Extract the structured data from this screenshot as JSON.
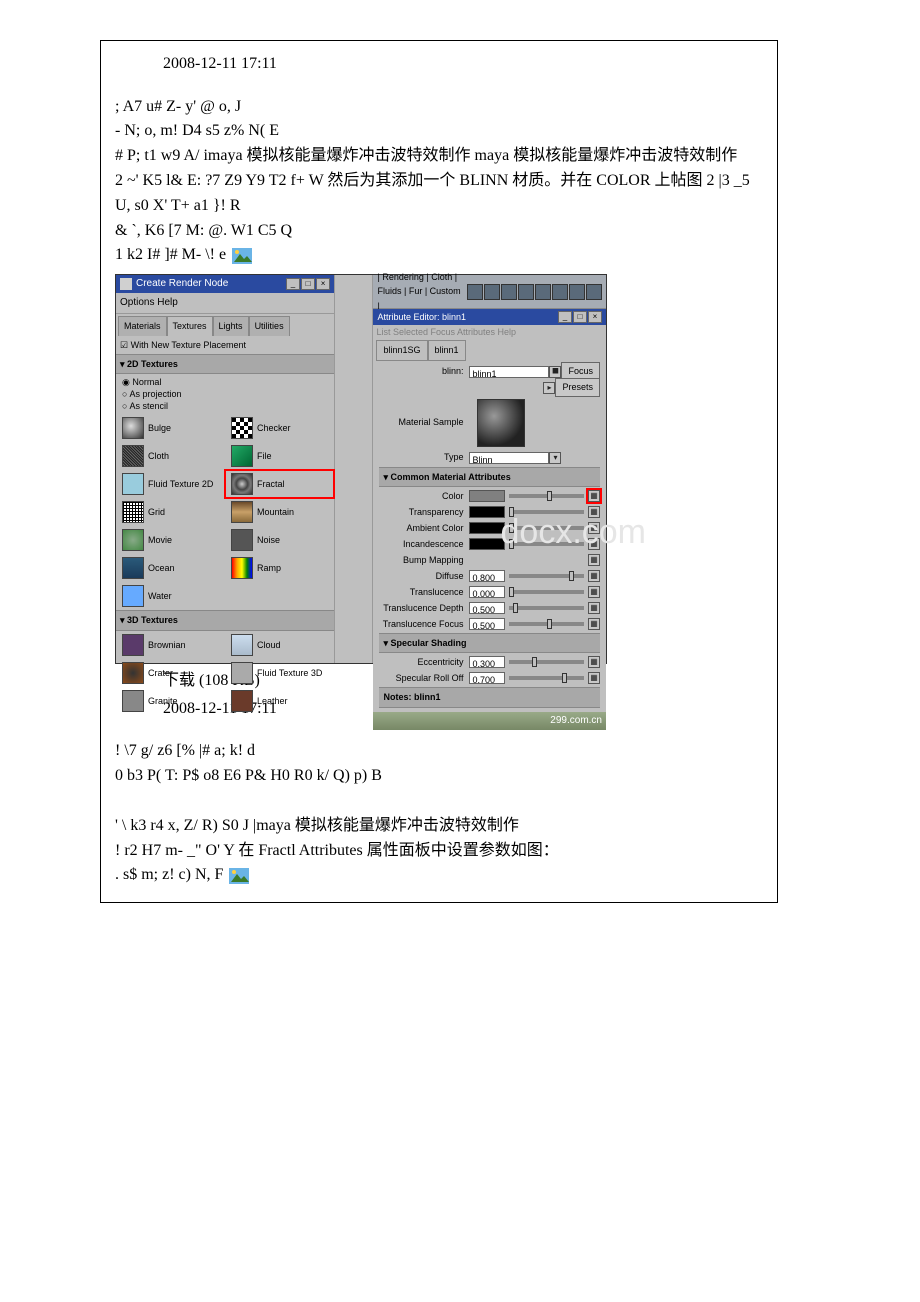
{
  "block1": {
    "timestamp": "2008-12-11 17:11",
    "lines": [
      "; A7 u# Z- y' @  o, J",
      "- N; o, m! D4 s5 z% N( E",
      "# P; t1 w9 A/ imaya 模拟核能量爆炸冲击波特效制作 maya 模拟核能量爆炸冲击波特效制作",
      "2 ~' K5 l& E: ?7 Z9 Y9 T2 f+ W 然后为其添加一个 BLINN 材质。并在 COLOR 上帖图 2 |3 _5 U, s0 X' T+ a1 }! R",
      "& `, K6 [7 M: @. W1 C5 Q",
      "1 k2 I# ]# M- \\! e"
    ]
  },
  "block2": {
    "download_label": "下载 (108 KB)",
    "timestamp": "2008-12-11 17:11",
    "lines": [
      "! \\7 g/ z6 [% |# a; k! d",
      "0 b3 P( T: P$ o8 E6 P& H0 R0 k/ Q) p) B",
      "",
      "' \\  k3 r4 x, Z/ R) S0 J  |maya 模拟核能量爆炸冲击波特效制作",
      "! r2 H7 m- _\" O' Y 在 Fractl Attributes 属性面板中设置参数如图：",
      ". s$ m; z! c) N, F"
    ]
  },
  "maya": {
    "left_title": "Create Render Node",
    "menubar": "Options  Help",
    "tabs": [
      "Materials",
      "Textures",
      "Lights",
      "Utilities"
    ],
    "active_tab": 1,
    "check_label": "With New Texture Placement",
    "section_2d": "2D Textures",
    "radios": [
      "Normal",
      "As projection",
      "As stencil"
    ],
    "active_radio": 0,
    "tex2d": [
      {
        "name": "Bulge"
      },
      {
        "name": "Checker"
      },
      {
        "name": "Cloth"
      },
      {
        "name": "File"
      },
      {
        "name": "Fluid Texture 2D"
      },
      {
        "name": "Fractal",
        "highlight": true
      },
      {
        "name": "Grid"
      },
      {
        "name": "Mountain"
      },
      {
        "name": "Movie"
      },
      {
        "name": "Noise"
      },
      {
        "name": "Ocean"
      },
      {
        "name": "Ramp"
      },
      {
        "name": "Water"
      },
      {
        "name": ""
      }
    ],
    "section_3d": "3D Textures",
    "tex3d": [
      {
        "name": "Brownian"
      },
      {
        "name": "Cloud"
      },
      {
        "name": "Crater"
      },
      {
        "name": "Fluid Texture 3D"
      },
      {
        "name": "Granite"
      },
      {
        "name": "Leather"
      }
    ],
    "shelf_tabs": "| Rendering | Cloth | Fluids | Fur |  Custom |",
    "attr": {
      "title": "Attribute Editor: blinn1",
      "menubar": "List  Selected  Focus  Attributes  Help",
      "tabs": [
        "blinn1SG",
        "blinn1"
      ],
      "name_label": "blinn:",
      "name_value": "blinn1",
      "focus_btn": "Focus",
      "presets_btn": "Presets",
      "sample_label": "Material Sample",
      "type_label": "Type",
      "type_value": "Blinn",
      "section_common": "Common Material Attributes",
      "rows": [
        {
          "label": "Color",
          "swatch": "#808080",
          "red": true
        },
        {
          "label": "Transparency",
          "swatch": "#000000"
        },
        {
          "label": "Ambient Color",
          "swatch": "#000000"
        },
        {
          "label": "Incandescence",
          "swatch": "#000000"
        },
        {
          "label": "Bump Mapping"
        },
        {
          "label": "Diffuse",
          "value": "0.800"
        },
        {
          "label": "Translucence",
          "value": "0.000"
        },
        {
          "label": "Translucence Depth",
          "value": "0.500"
        },
        {
          "label": "Translucence Focus",
          "value": "0.500"
        }
      ],
      "section_spec": "Specular Shading",
      "spec_rows": [
        {
          "label": "Eccentricity",
          "value": "0.300"
        },
        {
          "label": "Specular Roll Off",
          "value": "0.700"
        }
      ],
      "notes_label": "Notes: blinn1",
      "watermark": "299.com.cn"
    }
  }
}
